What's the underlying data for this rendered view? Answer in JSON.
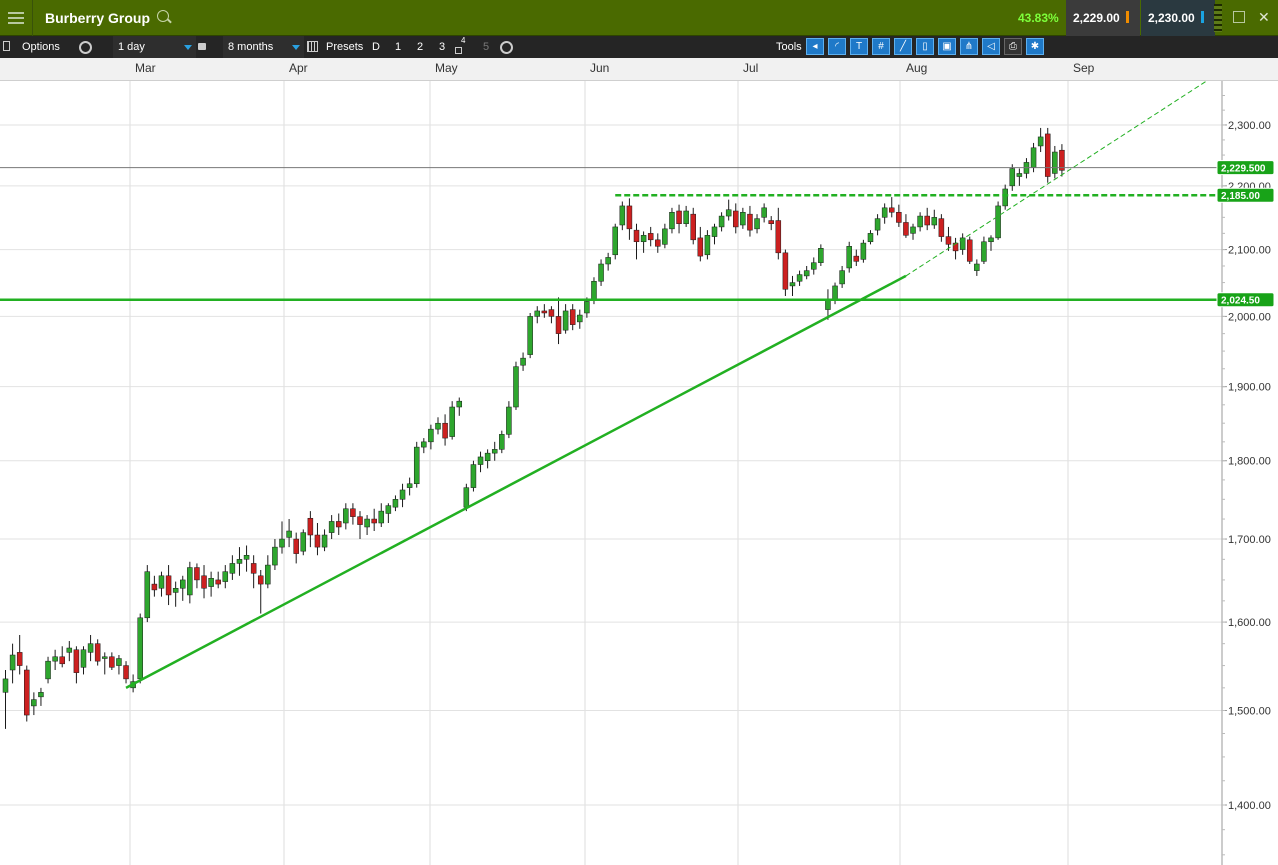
{
  "window": {
    "instrument_name": "Burberry Group",
    "change_pct": "43.83%",
    "sell_price": "2,229.00",
    "buy_price": "2,230.00"
  },
  "toolbar": {
    "options_label": "Options",
    "interval": "1 day",
    "period": "8 months",
    "presets_label": "Presets",
    "presets": [
      "D",
      "1",
      "2",
      "3",
      "4",
      "5"
    ],
    "tools_label": "Tools"
  },
  "chart_data": {
    "type": "candlestick",
    "x_months": [
      "Mar",
      "Apr",
      "May",
      "Jun",
      "Jul",
      "Aug",
      "Sep"
    ],
    "y_ticks": [
      "2,300.00",
      "2,200.00",
      "2,100.00",
      "2,000.00",
      "1,900.00",
      "1,800.00",
      "1,700.00",
      "1,600.00",
      "1,500.00",
      "1,400.00"
    ],
    "y_tick_values": [
      2300,
      2200,
      2100,
      2000,
      1900,
      1800,
      1700,
      1600,
      1500,
      1400
    ],
    "ylim": [
      1340,
      2375
    ],
    "current_price": 2229.5,
    "current_price_label": "2,229.500",
    "resistance_level": 2185.0,
    "resistance_label": "2,185.00",
    "support_level": 2024.5,
    "support_label": "2,024.50",
    "colors": {
      "up": "#2ea62e",
      "down": "#cc2020",
      "line": "#22b022",
      "label": "#18a318"
    },
    "candles": [
      [
        1520,
        1545,
        1480,
        1535
      ],
      [
        1545,
        1575,
        1530,
        1562
      ],
      [
        1565,
        1585,
        1540,
        1550
      ],
      [
        1545,
        1550,
        1488,
        1495
      ],
      [
        1505,
        1520,
        1495,
        1512
      ],
      [
        1515,
        1525,
        1505,
        1520
      ],
      [
        1535,
        1560,
        1530,
        1555
      ],
      [
        1555,
        1568,
        1545,
        1560
      ],
      [
        1560,
        1572,
        1548,
        1552
      ],
      [
        1565,
        1578,
        1555,
        1570
      ],
      [
        1568,
        1572,
        1530,
        1542
      ],
      [
        1548,
        1572,
        1540,
        1568
      ],
      [
        1565,
        1585,
        1555,
        1575
      ],
      [
        1575,
        1580,
        1550,
        1555
      ],
      [
        1558,
        1565,
        1540,
        1560
      ],
      [
        1560,
        1565,
        1545,
        1548
      ],
      [
        1550,
        1562,
        1540,
        1558
      ],
      [
        1550,
        1555,
        1530,
        1535
      ],
      [
        1525,
        1540,
        1520,
        1532
      ],
      [
        1535,
        1610,
        1530,
        1605
      ],
      [
        1605,
        1668,
        1600,
        1660
      ],
      [
        1645,
        1655,
        1630,
        1638
      ],
      [
        1640,
        1660,
        1630,
        1655
      ],
      [
        1655,
        1668,
        1620,
        1632
      ],
      [
        1635,
        1648,
        1618,
        1640
      ],
      [
        1640,
        1655,
        1625,
        1650
      ],
      [
        1632,
        1672,
        1622,
        1665
      ],
      [
        1665,
        1670,
        1640,
        1650
      ],
      [
        1655,
        1668,
        1628,
        1640
      ],
      [
        1642,
        1660,
        1630,
        1652
      ],
      [
        1650,
        1660,
        1640,
        1645
      ],
      [
        1648,
        1668,
        1640,
        1660
      ],
      [
        1658,
        1680,
        1650,
        1670
      ],
      [
        1670,
        1690,
        1655,
        1675
      ],
      [
        1675,
        1692,
        1660,
        1680
      ],
      [
        1670,
        1680,
        1640,
        1658
      ],
      [
        1655,
        1662,
        1610,
        1645
      ],
      [
        1645,
        1680,
        1640,
        1668
      ],
      [
        1668,
        1700,
        1662,
        1690
      ],
      [
        1690,
        1722,
        1682,
        1700
      ],
      [
        1702,
        1725,
        1690,
        1710
      ],
      [
        1700,
        1708,
        1670,
        1682
      ],
      [
        1685,
        1712,
        1680,
        1708
      ],
      [
        1726,
        1735,
        1690,
        1705
      ],
      [
        1705,
        1720,
        1680,
        1690
      ],
      [
        1690,
        1712,
        1685,
        1705
      ],
      [
        1708,
        1730,
        1700,
        1722
      ],
      [
        1722,
        1732,
        1705,
        1715
      ],
      [
        1720,
        1745,
        1712,
        1738
      ],
      [
        1738,
        1745,
        1718,
        1728
      ],
      [
        1728,
        1735,
        1700,
        1718
      ],
      [
        1715,
        1730,
        1705,
        1725
      ],
      [
        1725,
        1738,
        1710,
        1720
      ],
      [
        1720,
        1745,
        1715,
        1735
      ],
      [
        1732,
        1745,
        1720,
        1742
      ],
      [
        1740,
        1755,
        1735,
        1750
      ],
      [
        1750,
        1770,
        1740,
        1762
      ],
      [
        1765,
        1778,
        1755,
        1770
      ],
      [
        1770,
        1825,
        1765,
        1818
      ],
      [
        1818,
        1830,
        1810,
        1825
      ],
      [
        1825,
        1848,
        1815,
        1842
      ],
      [
        1842,
        1858,
        1835,
        1850
      ],
      [
        1850,
        1862,
        1820,
        1830
      ],
      [
        1832,
        1880,
        1828,
        1872
      ],
      [
        1872,
        1885,
        1860,
        1880
      ],
      [
        1740,
        1770,
        1735,
        1765
      ],
      [
        1765,
        1800,
        1760,
        1795
      ],
      [
        1795,
        1812,
        1785,
        1805
      ],
      [
        1800,
        1815,
        1790,
        1810
      ],
      [
        1810,
        1825,
        1800,
        1815
      ],
      [
        1815,
        1840,
        1810,
        1835
      ],
      [
        1835,
        1880,
        1830,
        1872
      ],
      [
        1872,
        1935,
        1868,
        1928
      ],
      [
        1930,
        1948,
        1922,
        1940
      ],
      [
        1945,
        2005,
        1940,
        2000
      ],
      [
        2000,
        2015,
        1990,
        2008
      ],
      [
        2008,
        2018,
        1998,
        2005
      ],
      [
        2010,
        2015,
        1990,
        2000
      ],
      [
        2000,
        2028,
        1960,
        1975
      ],
      [
        1980,
        2018,
        1975,
        2008
      ],
      [
        2010,
        2018,
        1980,
        1988
      ],
      [
        1992,
        2010,
        1982,
        2002
      ],
      [
        2005,
        2028,
        1998,
        2022
      ],
      [
        2025,
        2058,
        2018,
        2052
      ],
      [
        2052,
        2085,
        2045,
        2078
      ],
      [
        2078,
        2095,
        2068,
        2088
      ],
      [
        2092,
        2140,
        2085,
        2135
      ],
      [
        2138,
        2175,
        2130,
        2168
      ],
      [
        2168,
        2180,
        2115,
        2132
      ],
      [
        2130,
        2140,
        2085,
        2112
      ],
      [
        2112,
        2128,
        2095,
        2122
      ],
      [
        2125,
        2135,
        2105,
        2115
      ],
      [
        2115,
        2125,
        2095,
        2105
      ],
      [
        2108,
        2140,
        2102,
        2132
      ],
      [
        2132,
        2165,
        2125,
        2158
      ],
      [
        2160,
        2170,
        2125,
        2140
      ],
      [
        2140,
        2168,
        2135,
        2160
      ],
      [
        2155,
        2165,
        2108,
        2115
      ],
      [
        2118,
        2135,
        2082,
        2090
      ],
      [
        2092,
        2130,
        2085,
        2122
      ],
      [
        2120,
        2140,
        2108,
        2135
      ],
      [
        2135,
        2158,
        2128,
        2152
      ],
      [
        2152,
        2178,
        2145,
        2162
      ],
      [
        2160,
        2172,
        2125,
        2135
      ],
      [
        2138,
        2165,
        2132,
        2158
      ],
      [
        2155,
        2168,
        2120,
        2130
      ],
      [
        2132,
        2155,
        2125,
        2148
      ],
      [
        2150,
        2172,
        2142,
        2165
      ],
      [
        2145,
        2152,
        2130,
        2140
      ],
      [
        2145,
        2165,
        2085,
        2095
      ],
      [
        2095,
        2100,
        2030,
        2040
      ],
      [
        2045,
        2060,
        2030,
        2050
      ],
      [
        2052,
        2068,
        2045,
        2062
      ],
      [
        2060,
        2075,
        2055,
        2068
      ],
      [
        2070,
        2088,
        2062,
        2080
      ],
      [
        2080,
        2108,
        2075,
        2102
      ],
      [
        2010,
        2040,
        1995,
        2025
      ],
      [
        2025,
        2050,
        2018,
        2045
      ],
      [
        2048,
        2075,
        2042,
        2068
      ],
      [
        2072,
        2112,
        2065,
        2105
      ],
      [
        2090,
        2100,
        2075,
        2082
      ],
      [
        2085,
        2115,
        2080,
        2110
      ],
      [
        2112,
        2130,
        2108,
        2125
      ],
      [
        2130,
        2155,
        2122,
        2148
      ],
      [
        2150,
        2172,
        2140,
        2165
      ],
      [
        2165,
        2182,
        2150,
        2158
      ],
      [
        2158,
        2170,
        2135,
        2142
      ],
      [
        2142,
        2155,
        2118,
        2122
      ],
      [
        2125,
        2140,
        2115,
        2135
      ],
      [
        2135,
        2158,
        2128,
        2152
      ],
      [
        2152,
        2165,
        2130,
        2138
      ],
      [
        2138,
        2162,
        2132,
        2150
      ],
      [
        2148,
        2155,
        2112,
        2120
      ],
      [
        2120,
        2135,
        2098,
        2108
      ],
      [
        2110,
        2118,
        2085,
        2098
      ],
      [
        2100,
        2125,
        2092,
        2118
      ],
      [
        2115,
        2120,
        2078,
        2082
      ],
      [
        2068,
        2085,
        2060,
        2078
      ],
      [
        2082,
        2120,
        2078,
        2112
      ],
      [
        2112,
        2122,
        2098,
        2118
      ],
      [
        2118,
        2175,
        2115,
        2168
      ],
      [
        2168,
        2202,
        2162,
        2195
      ],
      [
        2200,
        2235,
        2192,
        2228
      ],
      [
        2215,
        2228,
        2200,
        2220
      ],
      [
        2220,
        2245,
        2212,
        2238
      ],
      [
        2230,
        2270,
        2222,
        2262
      ],
      [
        2265,
        2295,
        2255,
        2280
      ],
      [
        2285,
        2295,
        2205,
        2215
      ],
      [
        2220,
        2265,
        2212,
        2255
      ],
      [
        2258,
        2268,
        2215,
        2225
      ]
    ]
  }
}
